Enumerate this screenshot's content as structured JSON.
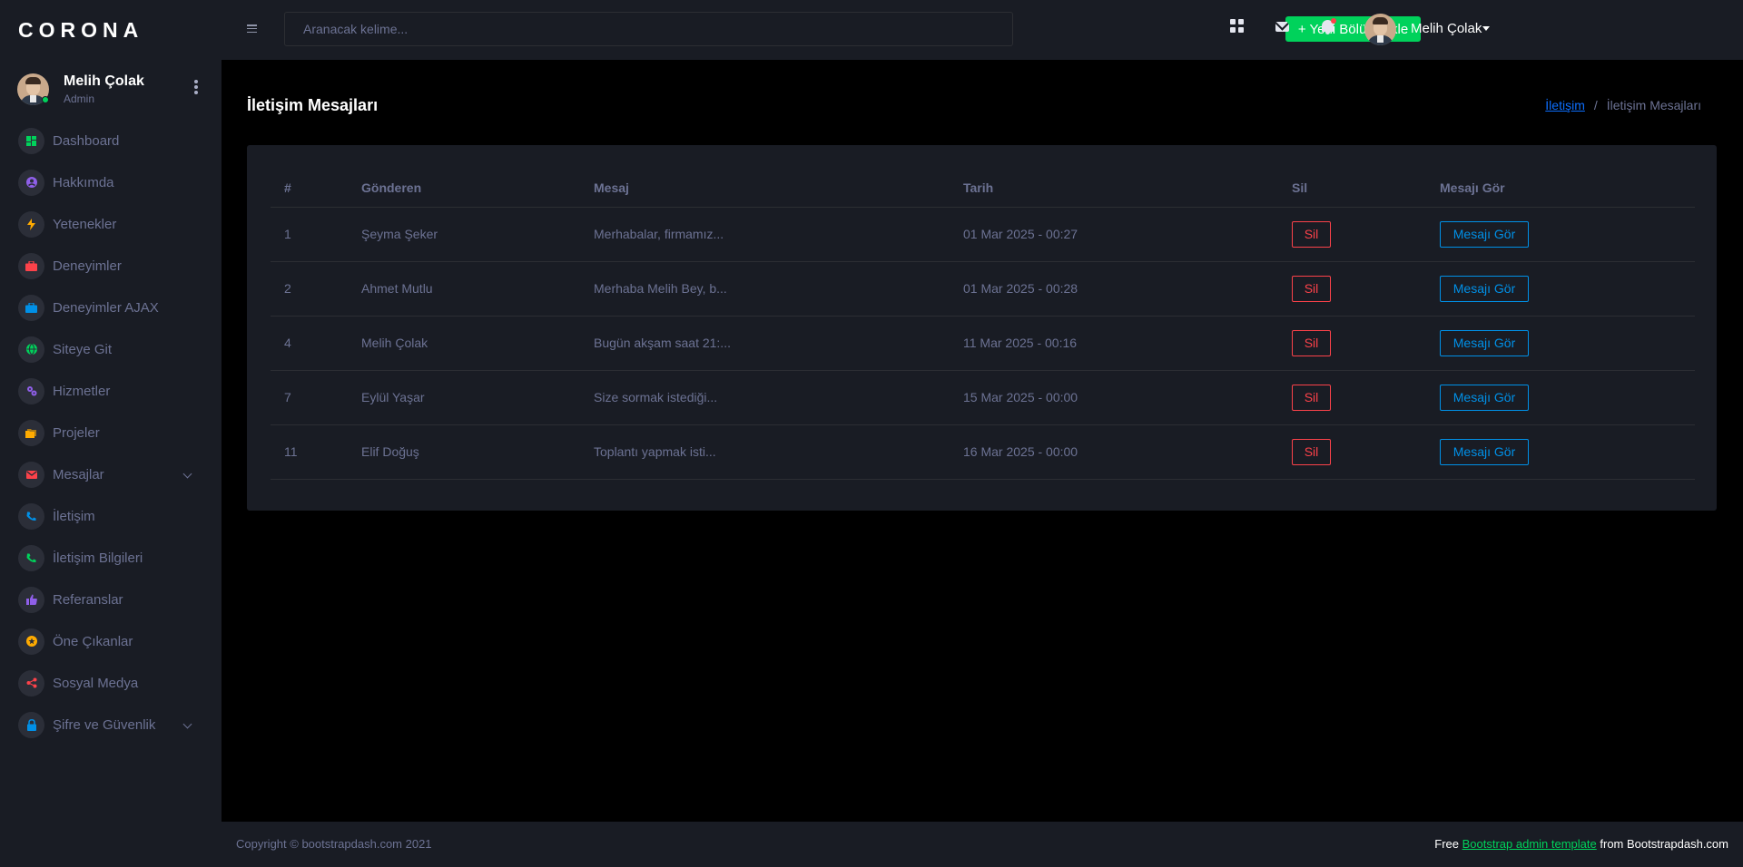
{
  "brand": "CORONA",
  "profile": {
    "name": "Melih Çolak",
    "role": "Admin"
  },
  "sidebar": {
    "items": [
      {
        "label": "Dashboard",
        "icon": "dashboard-icon",
        "color": "#00d25b",
        "has_submenu": false
      },
      {
        "label": "Hakkımda",
        "icon": "user-circle-icon",
        "color": "#8f5fe8",
        "has_submenu": false
      },
      {
        "label": "Yetenekler",
        "icon": "lightning-icon",
        "color": "#ffab00",
        "has_submenu": false
      },
      {
        "label": "Deneyimler",
        "icon": "briefcase-icon",
        "color": "#fc424a",
        "has_submenu": false
      },
      {
        "label": "Deneyimler AJAX",
        "icon": "briefcase-icon",
        "color": "#0090e7",
        "has_submenu": false
      },
      {
        "label": "Siteye Git",
        "icon": "globe-icon",
        "color": "#00d25b",
        "has_submenu": false
      },
      {
        "label": "Hizmetler",
        "icon": "gears-icon",
        "color": "#8f5fe8",
        "has_submenu": false
      },
      {
        "label": "Projeler",
        "icon": "folders-icon",
        "color": "#ffab00",
        "has_submenu": false
      },
      {
        "label": "Mesajlar",
        "icon": "mail-icon",
        "color": "#fc424a",
        "has_submenu": true
      },
      {
        "label": "İletişim",
        "icon": "phone-icon",
        "color": "#0090e7",
        "has_submenu": false
      },
      {
        "label": "İletişim Bilgileri",
        "icon": "phone-icon",
        "color": "#00d25b",
        "has_submenu": false
      },
      {
        "label": "Referanslar",
        "icon": "thumbs-up-icon",
        "color": "#8f5fe8",
        "has_submenu": false
      },
      {
        "label": "Öne Çıkanlar",
        "icon": "star-badge-icon",
        "color": "#ffab00",
        "has_submenu": false
      },
      {
        "label": "Sosyal Medya",
        "icon": "share-icon",
        "color": "#fc424a",
        "has_submenu": false
      },
      {
        "label": "Şifre ve Güvenlik",
        "icon": "lock-icon",
        "color": "#0090e7",
        "has_submenu": true
      }
    ]
  },
  "topbar": {
    "search_placeholder": "Aranacak kelime...",
    "new_section_label": "+ Yeni Bölüm Ekle",
    "user_name": "Melih Çolak"
  },
  "page": {
    "title": "İletişim Mesajları",
    "breadcrumb": {
      "link": "İletişim",
      "separator": "/",
      "current": "İletişim Mesajları"
    }
  },
  "table": {
    "headers": [
      "#",
      "Gönderen",
      "Mesaj",
      "Tarih",
      "Sil",
      "Mesajı Gör"
    ],
    "rows": [
      {
        "id": "1",
        "sender": "Şeyma Şeker",
        "message": "Merhabalar, firmamız...",
        "date": "01 Mar 2025 - 00:27",
        "delete": "Sil",
        "view": "Mesajı Gör"
      },
      {
        "id": "2",
        "sender": "Ahmet Mutlu",
        "message": "Merhaba Melih Bey, b...",
        "date": "01 Mar 2025 - 00:28",
        "delete": "Sil",
        "view": "Mesajı Gör"
      },
      {
        "id": "4",
        "sender": "Melih Çolak",
        "message": "Bugün akşam saat 21:...",
        "date": "11 Mar 2025 - 00:16",
        "delete": "Sil",
        "view": "Mesajı Gör"
      },
      {
        "id": "7",
        "sender": "Eylül Yaşar",
        "message": "Size sormak istediği...",
        "date": "15 Mar 2025 - 00:00",
        "delete": "Sil",
        "view": "Mesajı Gör"
      },
      {
        "id": "11",
        "sender": "Elif Doğuş",
        "message": "Toplantı yapmak isti...",
        "date": "16 Mar 2025 - 00:00",
        "delete": "Sil",
        "view": "Mesajı Gör"
      }
    ]
  },
  "footer": {
    "copyright": "Copyright © bootstrapdash.com 2021",
    "prefix": "Free",
    "link": "Bootstrap admin template",
    "suffix": "from Bootstrapdash.com"
  },
  "colors": {
    "background": "#000000",
    "panel": "#191c24",
    "muted_text": "#6c7293",
    "success": "#00d25b",
    "danger": "#fc424a",
    "info": "#0090e7"
  }
}
